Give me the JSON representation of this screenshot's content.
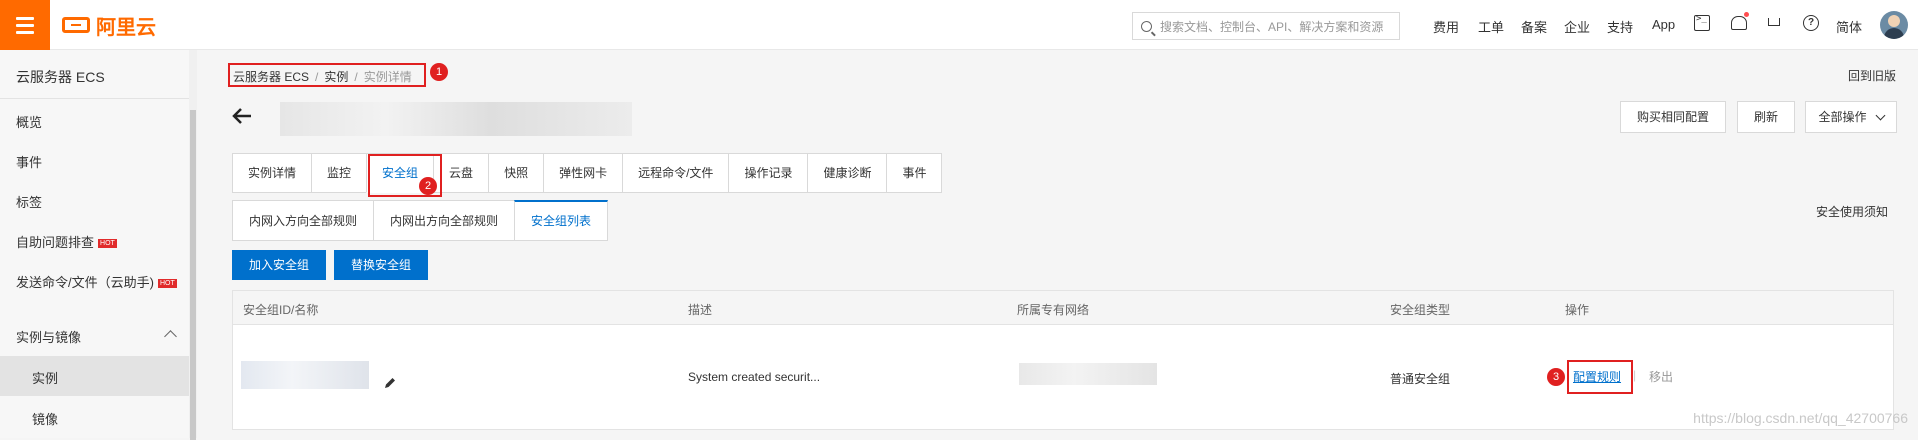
{
  "header": {
    "logo_text": "阿里云",
    "search_placeholder": "搜索文档、控制台、API、解决方案和资源",
    "links": [
      "费用",
      "工单",
      "备案",
      "企业",
      "支持",
      "App"
    ],
    "language": "简体",
    "brand_color": "#ff6a00"
  },
  "sidebar": {
    "title": "云服务器 ECS",
    "items": [
      {
        "label": "概览"
      },
      {
        "label": "事件"
      },
      {
        "label": "标签"
      },
      {
        "label": "自助问题排查",
        "badge": "HOT"
      },
      {
        "label": "发送命令/文件（云助手)",
        "badge": "HOT"
      }
    ],
    "group": "实例与镜像",
    "group_items": [
      "实例",
      "镜像"
    ],
    "active_item": "实例"
  },
  "breadcrumb": {
    "items": [
      "云服务器 ECS",
      "实例",
      "实例详情"
    ]
  },
  "annotations": [
    "1",
    "2",
    "3"
  ],
  "page": {
    "back_to_old": "回到旧版",
    "buttons": {
      "buy_same": "购买相同配置",
      "refresh": "刷新",
      "all_ops": "全部操作"
    }
  },
  "tabs": [
    "实例详情",
    "监控",
    "安全组",
    "云盘",
    "快照",
    "弹性网卡",
    "远程命令/文件",
    "操作记录",
    "健康诊断",
    "事件"
  ],
  "active_tab": "安全组",
  "subtabs": [
    "内网入方向全部规则",
    "内网出方向全部规则",
    "安全组列表"
  ],
  "active_subtab": "安全组列表",
  "notice": "安全使用须知",
  "actions": {
    "add": "加入安全组",
    "replace": "替换安全组"
  },
  "table": {
    "columns": [
      "安全组ID/名称",
      "描述",
      "所属专有网络",
      "安全组类型",
      "操作"
    ],
    "rows": [
      {
        "description": "System created securit...",
        "type": "普通安全组",
        "ops": [
          "配置规则",
          "移出"
        ]
      }
    ]
  },
  "watermark": "https://blog.csdn.net/qq_42700766",
  "colors": {
    "accent": "#0070cc",
    "annotation": "#e02020"
  }
}
